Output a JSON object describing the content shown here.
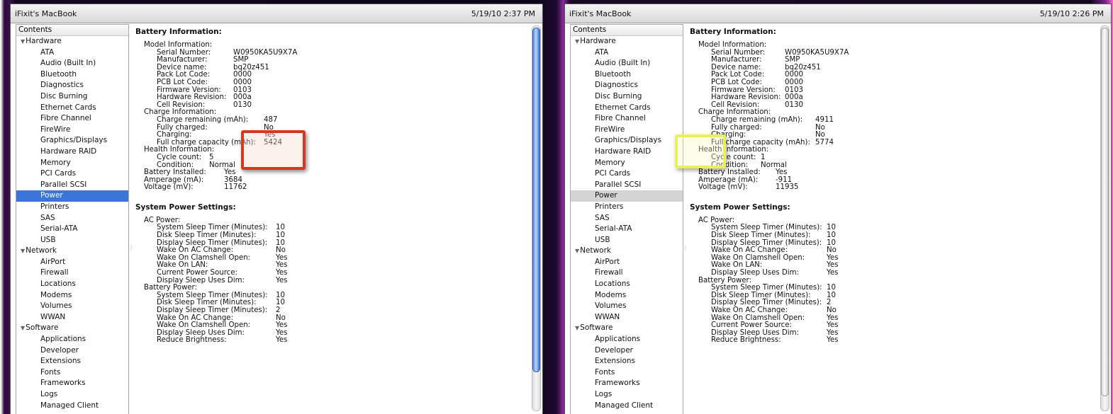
{
  "left_window": {
    "title": "iFixit's MacBook",
    "time": "5/19/10 2:37 PM",
    "sidebar_header": "Contents",
    "selected": "Power",
    "battery": {
      "section_title": "Battery Information:",
      "model_header": "Model Information:",
      "model": [
        {
          "label": "Serial Number:",
          "value": "W0950KA5U9X7A"
        },
        {
          "label": "Manufacturer:",
          "value": "SMP"
        },
        {
          "label": "Device name:",
          "value": "bq20z451"
        },
        {
          "label": "Pack Lot Code:",
          "value": "0000"
        },
        {
          "label": "PCB Lot Code:",
          "value": "0000"
        },
        {
          "label": "Firmware Version:",
          "value": "0103"
        },
        {
          "label": "Hardware Revision:",
          "value": "000a"
        },
        {
          "label": "Cell Revision:",
          "value": "0130"
        }
      ],
      "charge_header": "Charge Information:",
      "charge": [
        {
          "label": "Charge remaining (mAh):",
          "value": "487"
        },
        {
          "label": "Fully charged:",
          "value": "No"
        },
        {
          "label": "Charging:",
          "value": "Yes"
        },
        {
          "label": "Full charge capacity (mAh):",
          "value": "5424"
        }
      ],
      "health_header": "Health Information:",
      "health": [
        {
          "label": "Cycle count:",
          "value": "5"
        },
        {
          "label": "Condition:",
          "value": "Normal"
        }
      ],
      "battery_rows": [
        {
          "label": "Battery Installed:",
          "value": "Yes"
        },
        {
          "label": "Amperage (mA):",
          "value": "3684"
        },
        {
          "label": "Voltage (mV):",
          "value": "11762"
        }
      ]
    },
    "power": {
      "section_title": "System Power Settings:",
      "ac_header": "AC Power:",
      "ac": [
        {
          "label": "System Sleep Timer (Minutes):",
          "value": "10"
        },
        {
          "label": "Disk Sleep Timer (Minutes):",
          "value": "10"
        },
        {
          "label": "Display Sleep Timer (Minutes):",
          "value": "10"
        },
        {
          "label": "Wake On AC Change:",
          "value": "No"
        },
        {
          "label": "Wake On Clamshell Open:",
          "value": "Yes"
        },
        {
          "label": "Wake On LAN:",
          "value": "Yes"
        },
        {
          "label": "Current Power Source:",
          "value": "Yes"
        },
        {
          "label": "Display Sleep Uses Dim:",
          "value": "Yes"
        }
      ],
      "batt_header": "Battery Power:",
      "batt": [
        {
          "label": "System Sleep Timer (Minutes):",
          "value": "10"
        },
        {
          "label": "Disk Sleep Timer (Minutes):",
          "value": "10"
        },
        {
          "label": "Display Sleep Timer (Minutes):",
          "value": "2"
        },
        {
          "label": "Wake On AC Change:",
          "value": "No"
        },
        {
          "label": "Wake On Clamshell Open:",
          "value": "Yes"
        },
        {
          "label": "Display Sleep Uses Dim:",
          "value": "Yes"
        },
        {
          "label": "Reduce Brightness:",
          "value": "Yes"
        }
      ]
    }
  },
  "right_window": {
    "title": "iFixit's MacBook",
    "time": "5/19/10 2:26 PM",
    "sidebar_header": "Contents",
    "selected": "Power",
    "battery": {
      "section_title": "Battery Information:",
      "model_header": "Model Information:",
      "model": [
        {
          "label": "Serial Number:",
          "value": "W0950KA5U9X7A"
        },
        {
          "label": "Manufacturer:",
          "value": "SMP"
        },
        {
          "label": "Device name:",
          "value": "bq20z451"
        },
        {
          "label": "Pack Lot Code:",
          "value": "0000"
        },
        {
          "label": "PCB Lot Code:",
          "value": "0000"
        },
        {
          "label": "Firmware Version:",
          "value": "0103"
        },
        {
          "label": "Hardware Revision:",
          "value": "000a"
        },
        {
          "label": "Cell Revision:",
          "value": "0130"
        }
      ],
      "charge_header": "Charge Information:",
      "charge": [
        {
          "label": "Charge remaining (mAh):",
          "value": "4911"
        },
        {
          "label": "Fully charged:",
          "value": "No"
        },
        {
          "label": "Charging:",
          "value": "No"
        },
        {
          "label": "Full charge capacity (mAh):",
          "value": "5774"
        }
      ],
      "health_header": "Health Information:",
      "health": [
        {
          "label": "Cycle count:",
          "value": "1"
        },
        {
          "label": "Condition:",
          "value": "Normal"
        }
      ],
      "battery_rows": [
        {
          "label": "Battery Installed:",
          "value": "Yes"
        },
        {
          "label": "Amperage (mA):",
          "value": "-911"
        },
        {
          "label": "Voltage (mV):",
          "value": "11935"
        }
      ]
    },
    "power": {
      "section_title": "System Power Settings:",
      "ac_header": "AC Power:",
      "ac": [
        {
          "label": "System Sleep Timer (Minutes):",
          "value": "10"
        },
        {
          "label": "Disk Sleep Timer (Minutes):",
          "value": "10"
        },
        {
          "label": "Display Sleep Timer (Minutes):",
          "value": "10"
        },
        {
          "label": "Wake On AC Change:",
          "value": "No"
        },
        {
          "label": "Wake On Clamshell Open:",
          "value": "Yes"
        },
        {
          "label": "Wake On LAN:",
          "value": "Yes"
        },
        {
          "label": "Display Sleep Uses Dim:",
          "value": "Yes"
        }
      ],
      "batt_header": "Battery Power:",
      "batt": [
        {
          "label": "System Sleep Timer (Minutes):",
          "value": "10"
        },
        {
          "label": "Disk Sleep Timer (Minutes):",
          "value": "10"
        },
        {
          "label": "Display Sleep Timer (Minutes):",
          "value": "2"
        },
        {
          "label": "Wake On AC Change:",
          "value": "No"
        },
        {
          "label": "Wake On Clamshell Open:",
          "value": "Yes"
        },
        {
          "label": "Current Power Source:",
          "value": "Yes"
        },
        {
          "label": "Display Sleep Uses Dim:",
          "value": "Yes"
        },
        {
          "label": "Reduce Brightness:",
          "value": "Yes"
        }
      ]
    }
  },
  "tree": [
    {
      "category": "Hardware",
      "items": [
        "ATA",
        "Audio (Built In)",
        "Bluetooth",
        "Diagnostics",
        "Disc Burning",
        "Ethernet Cards",
        "Fibre Channel",
        "FireWire",
        "Graphics/Displays",
        "Hardware RAID",
        "Memory",
        "PCI Cards",
        "Parallel SCSI",
        "Power",
        "Printers",
        "SAS",
        "Serial-ATA",
        "USB"
      ]
    },
    {
      "category": "Network",
      "items": [
        "AirPort",
        "Firewall",
        "Locations",
        "Modems",
        "Volumes",
        "WWAN"
      ]
    },
    {
      "category": "Software",
      "items": [
        "Applications",
        "Developer",
        "Extensions",
        "Fonts",
        "Frameworks",
        "Logs",
        "Managed Client"
      ]
    }
  ],
  "colors": {
    "selection_blue": "#3b75d9",
    "selection_gray": "#d4d4d4",
    "highlight_red": "#d53a1f",
    "highlight_yellow": "#eaf05a"
  }
}
